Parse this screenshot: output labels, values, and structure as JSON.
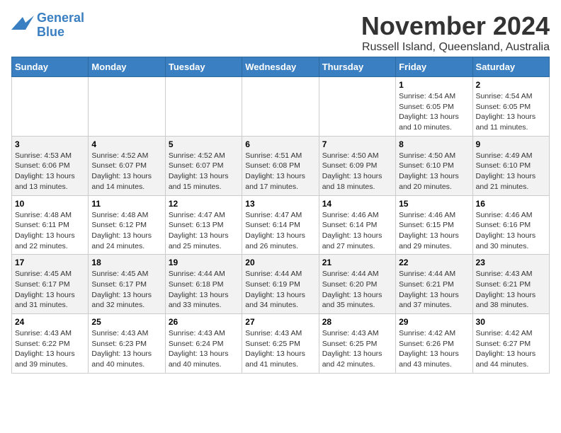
{
  "logo": {
    "line1": "General",
    "line2": "Blue"
  },
  "title": "November 2024",
  "subtitle": "Russell Island, Queensland, Australia",
  "days_of_week": [
    "Sunday",
    "Monday",
    "Tuesday",
    "Wednesday",
    "Thursday",
    "Friday",
    "Saturday"
  ],
  "weeks": [
    [
      {
        "day": "",
        "info": ""
      },
      {
        "day": "",
        "info": ""
      },
      {
        "day": "",
        "info": ""
      },
      {
        "day": "",
        "info": ""
      },
      {
        "day": "",
        "info": ""
      },
      {
        "day": "1",
        "info": "Sunrise: 4:54 AM\nSunset: 6:05 PM\nDaylight: 13 hours and 10 minutes."
      },
      {
        "day": "2",
        "info": "Sunrise: 4:54 AM\nSunset: 6:05 PM\nDaylight: 13 hours and 11 minutes."
      }
    ],
    [
      {
        "day": "3",
        "info": "Sunrise: 4:53 AM\nSunset: 6:06 PM\nDaylight: 13 hours and 13 minutes."
      },
      {
        "day": "4",
        "info": "Sunrise: 4:52 AM\nSunset: 6:07 PM\nDaylight: 13 hours and 14 minutes."
      },
      {
        "day": "5",
        "info": "Sunrise: 4:52 AM\nSunset: 6:07 PM\nDaylight: 13 hours and 15 minutes."
      },
      {
        "day": "6",
        "info": "Sunrise: 4:51 AM\nSunset: 6:08 PM\nDaylight: 13 hours and 17 minutes."
      },
      {
        "day": "7",
        "info": "Sunrise: 4:50 AM\nSunset: 6:09 PM\nDaylight: 13 hours and 18 minutes."
      },
      {
        "day": "8",
        "info": "Sunrise: 4:50 AM\nSunset: 6:10 PM\nDaylight: 13 hours and 20 minutes."
      },
      {
        "day": "9",
        "info": "Sunrise: 4:49 AM\nSunset: 6:10 PM\nDaylight: 13 hours and 21 minutes."
      }
    ],
    [
      {
        "day": "10",
        "info": "Sunrise: 4:48 AM\nSunset: 6:11 PM\nDaylight: 13 hours and 22 minutes."
      },
      {
        "day": "11",
        "info": "Sunrise: 4:48 AM\nSunset: 6:12 PM\nDaylight: 13 hours and 24 minutes."
      },
      {
        "day": "12",
        "info": "Sunrise: 4:47 AM\nSunset: 6:13 PM\nDaylight: 13 hours and 25 minutes."
      },
      {
        "day": "13",
        "info": "Sunrise: 4:47 AM\nSunset: 6:14 PM\nDaylight: 13 hours and 26 minutes."
      },
      {
        "day": "14",
        "info": "Sunrise: 4:46 AM\nSunset: 6:14 PM\nDaylight: 13 hours and 27 minutes."
      },
      {
        "day": "15",
        "info": "Sunrise: 4:46 AM\nSunset: 6:15 PM\nDaylight: 13 hours and 29 minutes."
      },
      {
        "day": "16",
        "info": "Sunrise: 4:46 AM\nSunset: 6:16 PM\nDaylight: 13 hours and 30 minutes."
      }
    ],
    [
      {
        "day": "17",
        "info": "Sunrise: 4:45 AM\nSunset: 6:17 PM\nDaylight: 13 hours and 31 minutes."
      },
      {
        "day": "18",
        "info": "Sunrise: 4:45 AM\nSunset: 6:17 PM\nDaylight: 13 hours and 32 minutes."
      },
      {
        "day": "19",
        "info": "Sunrise: 4:44 AM\nSunset: 6:18 PM\nDaylight: 13 hours and 33 minutes."
      },
      {
        "day": "20",
        "info": "Sunrise: 4:44 AM\nSunset: 6:19 PM\nDaylight: 13 hours and 34 minutes."
      },
      {
        "day": "21",
        "info": "Sunrise: 4:44 AM\nSunset: 6:20 PM\nDaylight: 13 hours and 35 minutes."
      },
      {
        "day": "22",
        "info": "Sunrise: 4:44 AM\nSunset: 6:21 PM\nDaylight: 13 hours and 37 minutes."
      },
      {
        "day": "23",
        "info": "Sunrise: 4:43 AM\nSunset: 6:21 PM\nDaylight: 13 hours and 38 minutes."
      }
    ],
    [
      {
        "day": "24",
        "info": "Sunrise: 4:43 AM\nSunset: 6:22 PM\nDaylight: 13 hours and 39 minutes."
      },
      {
        "day": "25",
        "info": "Sunrise: 4:43 AM\nSunset: 6:23 PM\nDaylight: 13 hours and 40 minutes."
      },
      {
        "day": "26",
        "info": "Sunrise: 4:43 AM\nSunset: 6:24 PM\nDaylight: 13 hours and 40 minutes."
      },
      {
        "day": "27",
        "info": "Sunrise: 4:43 AM\nSunset: 6:25 PM\nDaylight: 13 hours and 41 minutes."
      },
      {
        "day": "28",
        "info": "Sunrise: 4:43 AM\nSunset: 6:25 PM\nDaylight: 13 hours and 42 minutes."
      },
      {
        "day": "29",
        "info": "Sunrise: 4:42 AM\nSunset: 6:26 PM\nDaylight: 13 hours and 43 minutes."
      },
      {
        "day": "30",
        "info": "Sunrise: 4:42 AM\nSunset: 6:27 PM\nDaylight: 13 hours and 44 minutes."
      }
    ]
  ]
}
